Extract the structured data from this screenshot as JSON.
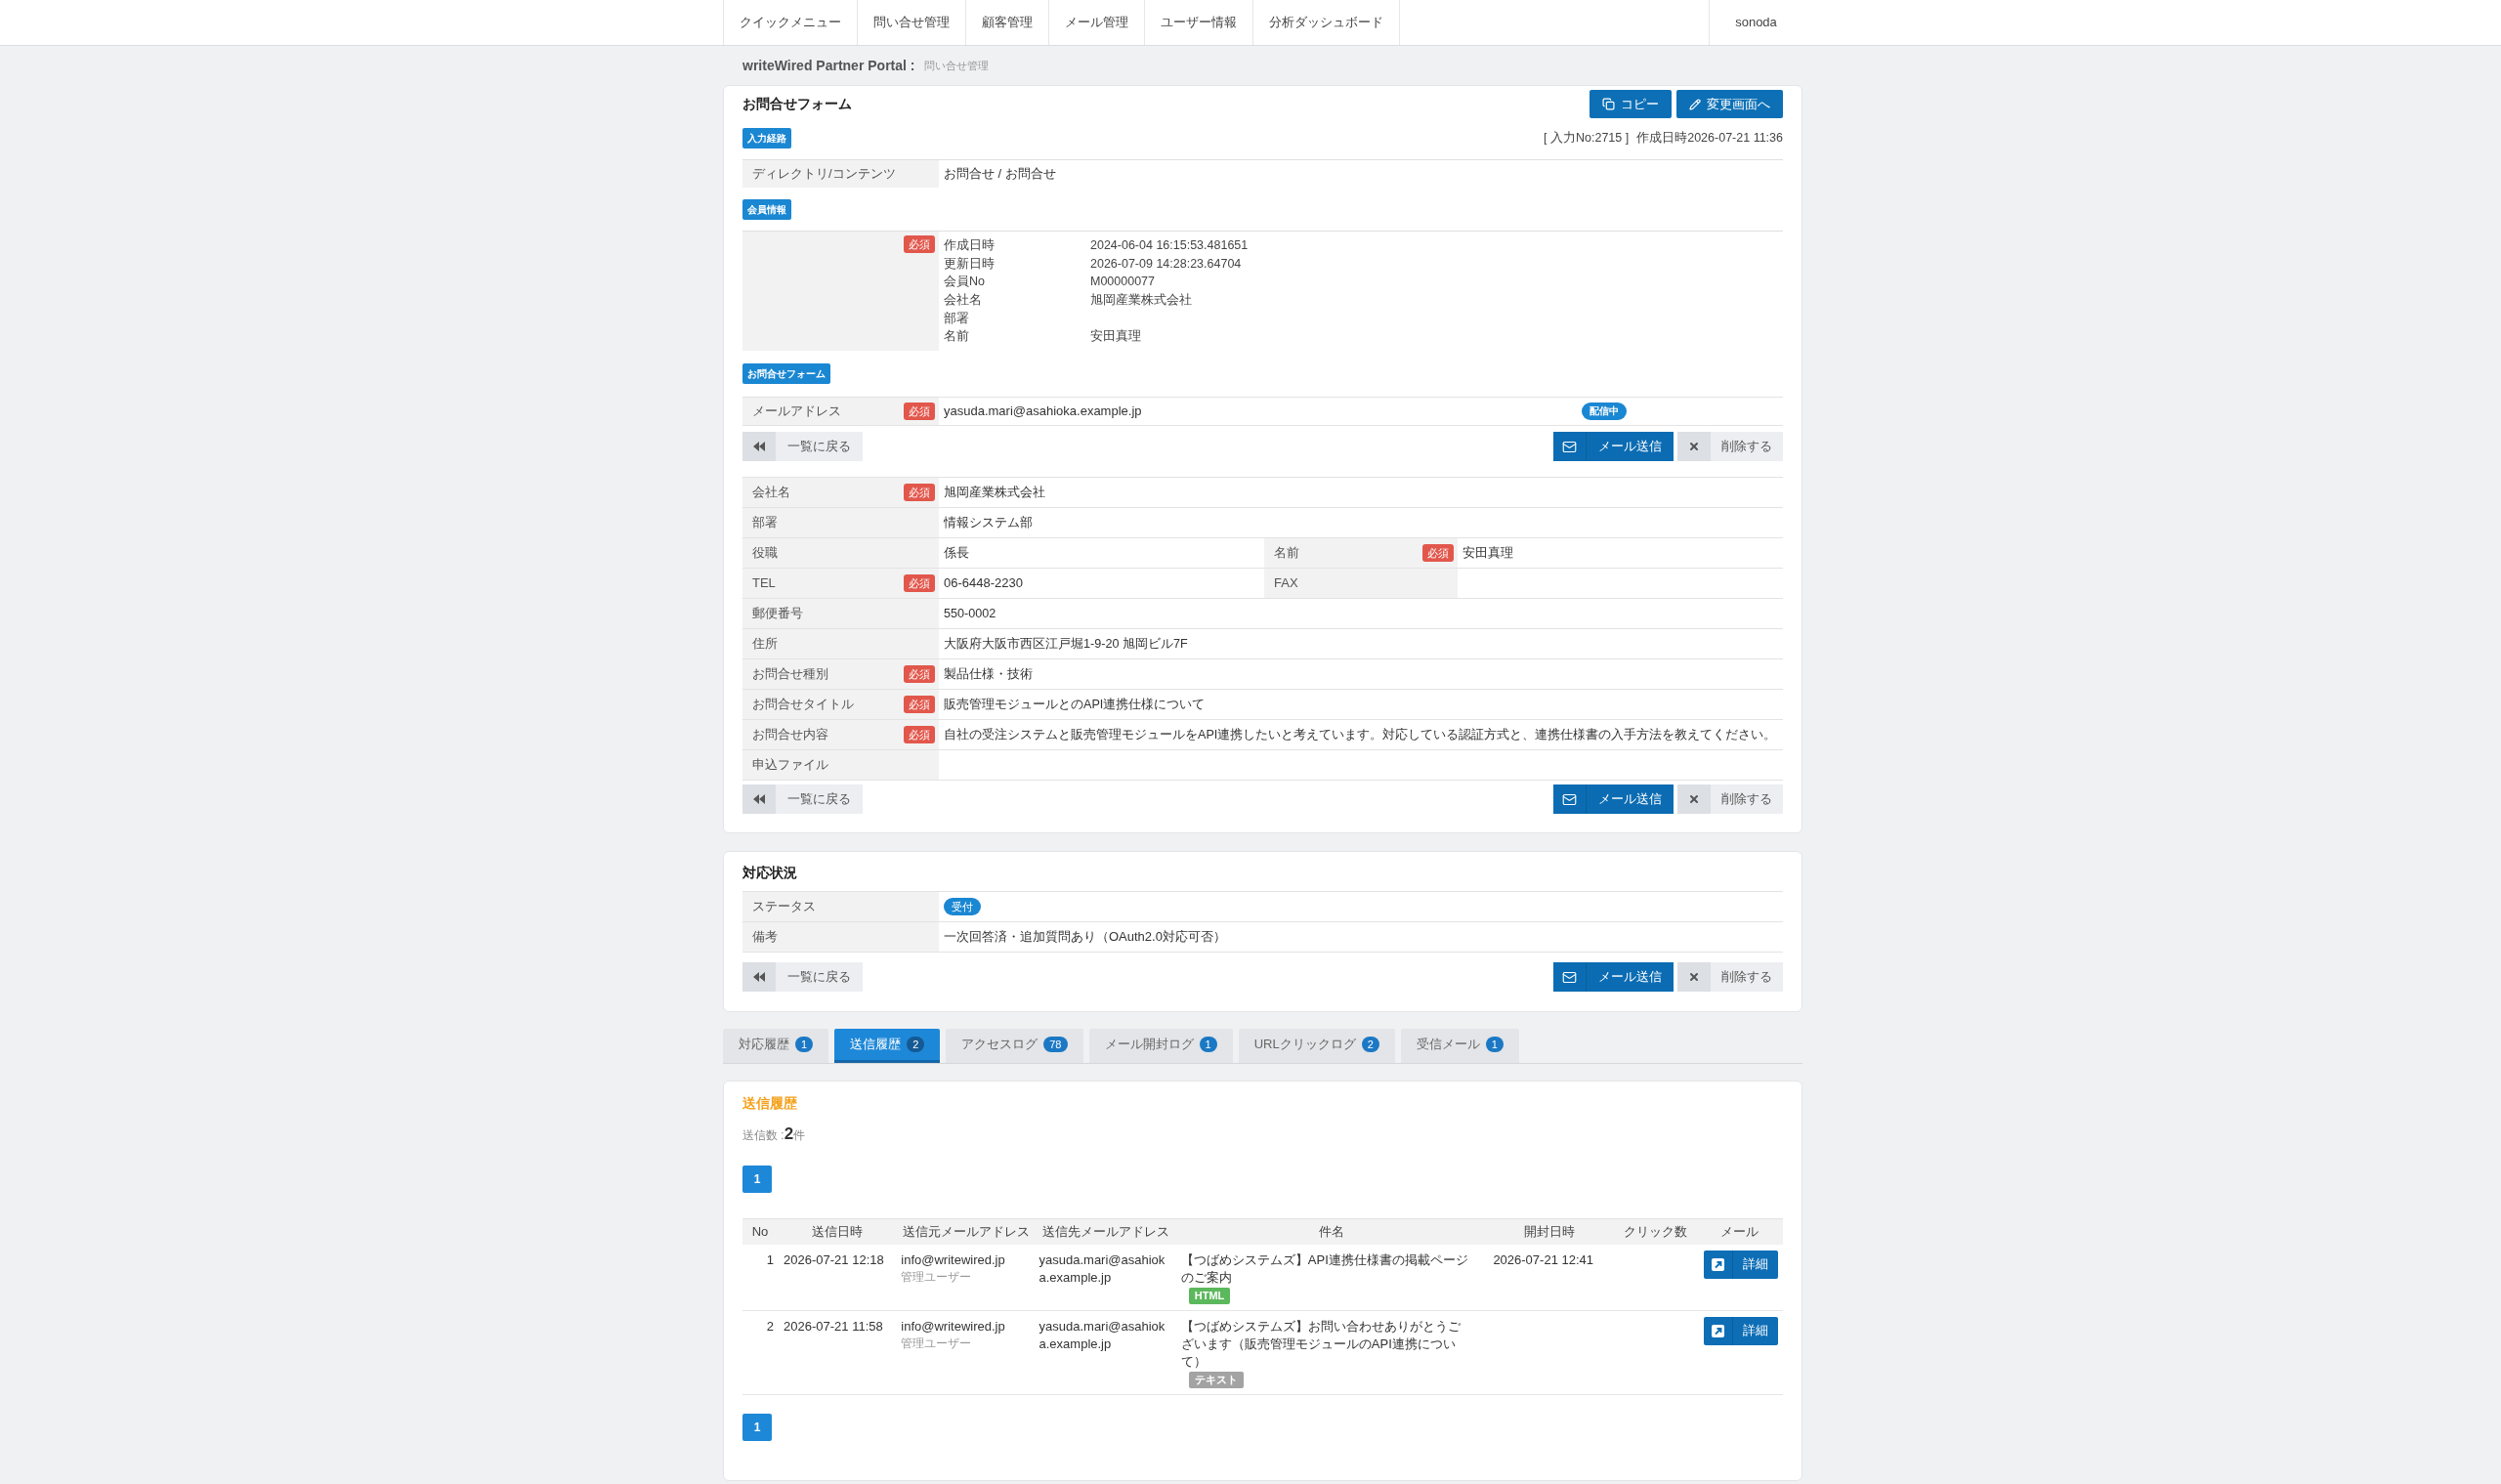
{
  "nav": {
    "items": [
      {
        "label": "クイックメニュー"
      },
      {
        "label": "問い合せ管理"
      },
      {
        "label": "顧客管理"
      },
      {
        "label": "メール管理"
      },
      {
        "label": "ユーザー情報"
      },
      {
        "label": "分析ダッシュボード"
      }
    ],
    "user": "sonoda"
  },
  "breadcrumb": {
    "site": "writeWired Partner Portal :",
    "page": "問い合せ管理"
  },
  "inquiry_form": {
    "title": "お問合せフォーム",
    "actions": [
      {
        "label": "コピー",
        "kind": "copy"
      },
      {
        "label": "変更画面へ",
        "kind": "edit"
      }
    ],
    "entry_no": "[ 入力No:2715 ]",
    "created": "作成日時2026-07-21 11:36",
    "route": {
      "badge": "入力経路",
      "rows": [
        {
          "label": "ディレクトリ/コンテンツ",
          "value": "お問合せ / お問合せ"
        }
      ]
    },
    "member": {
      "badge": "会員情報",
      "required_badge": "必須",
      "fields": [
        {
          "label": "作成日時",
          "value": "2024-06-04 16:15:53.481651"
        },
        {
          "label": "更新日時",
          "value": "2026-07-09 14:28:23.64704"
        },
        {
          "label": "会員No",
          "value": "M00000077"
        },
        {
          "label": "会社名",
          "value": "旭岡産業株式会社"
        },
        {
          "label": "部署"
        },
        {
          "label": "名前",
          "value": "安田真理"
        }
      ]
    },
    "form": {
      "badge": "お問合せフォーム",
      "email": {
        "label": "メールアドレス",
        "required_badge": "必須",
        "value": "yasuda.mari@asahioka.example.jp",
        "status": "配信中"
      },
      "buttons_top": {
        "back": "一覧に戻る",
        "send": "メール送信",
        "delete": "削除する"
      },
      "rows": [
        {
          "cells": [
            {
              "label": "会社名",
              "required_badge": "必須",
              "value": "旭岡産業株式会社"
            }
          ]
        },
        {
          "cells": [
            {
              "label": "部署",
              "value": "情報システム部"
            }
          ]
        },
        {
          "cells": [
            {
              "label": "役職",
              "value": "係長"
            },
            {
              "label": "名前",
              "required_badge": "必須",
              "value": "安田真理"
            }
          ]
        },
        {
          "cells": [
            {
              "label": "TEL",
              "required_badge": "必須",
              "value": "06-6448-2230"
            },
            {
              "label": "FAX"
            }
          ]
        },
        {
          "cells": [
            {
              "label": "郵便番号",
              "value": "550-0002"
            }
          ]
        },
        {
          "cells": [
            {
              "label": "住所",
              "value": "大阪府大阪市西区江戸堀1-9-20 旭岡ビル7F"
            }
          ]
        },
        {
          "cells": [
            {
              "label": "お問合せ種別",
              "required_badge": "必須",
              "value": "製品仕様・技術"
            }
          ]
        },
        {
          "cells": [
            {
              "label": "お問合せタイトル",
              "required_badge": "必須",
              "value": "販売管理モジュールとのAPI連携仕様について"
            }
          ]
        },
        {
          "cells": [
            {
              "label": "お問合せ内容",
              "required_badge": "必須",
              "value": "自社の受注システムと販売管理モジュールをAPI連携したいと考えています。対応している認証方式と、連携仕様書の入手方法を教えてください。"
            }
          ]
        },
        {
          "cells": [
            {
              "label": "申込ファイル"
            }
          ]
        }
      ],
      "buttons_bottom": {
        "back": "一覧に戻る",
        "send": "メール送信",
        "delete": "削除する"
      }
    }
  },
  "response_status": {
    "title": "対応状況",
    "rows": [
      {
        "label": "ステータス",
        "kind": "badge",
        "value": "受付"
      },
      {
        "label": "備考",
        "kind": "text",
        "value": "一次回答済・追加質問あり（OAuth2.0対応可否）"
      }
    ],
    "buttons": {
      "back": "一覧に戻る",
      "send": "メール送信",
      "delete": "削除する"
    }
  },
  "tabs": [
    {
      "label": "対応履歴",
      "count": "1",
      "selected": false
    },
    {
      "label": "送信履歴",
      "count": "2",
      "selected": true
    },
    {
      "label": "アクセスログ",
      "count": "78",
      "selected": false
    },
    {
      "label": "メール開封ログ",
      "count": "1",
      "selected": false
    },
    {
      "label": "URLクリックログ",
      "count": "2",
      "selected": false
    },
    {
      "label": "受信メール",
      "count": "1",
      "selected": false
    }
  ],
  "send_history": {
    "title": "送信履歴",
    "summary": "送信数 :**2**件",
    "pagination_top": [
      {
        "label": "1",
        "selected": true
      }
    ],
    "table": {
      "columns": [
        "No",
        "送信日時",
        "送信元メールアドレス",
        "送信先メールアドレス",
        "件名",
        "開封日時",
        "クリック数",
        "メール"
      ],
      "rows": [
        {
          "no": "1",
          "sent_at": "2026-07-21 12:18",
          "from": "info@writewired.jp",
          "from_role": "管理ユーザー",
          "to": "yasuda.mari@asahioka.example.jp",
          "subject": "【つばめシステムズ】API連携仕様書の掲載ページのご案内",
          "format": {
            "label": "HTML",
            "color": "#5cb85c"
          },
          "opened_at": "2026-07-21 12:41",
          "action": "詳細"
        },
        {
          "no": "2",
          "sent_at": "2026-07-21 11:58",
          "from": "info@writewired.jp",
          "from_role": "管理ユーザー",
          "to": "yasuda.mari@asahioka.example.jp",
          "subject": "【つばめシステムズ】お問い合わせありがとうございます（販売管理モジュールのAPI連携について）",
          "format": {
            "label": "テキスト",
            "color": "#a3a3a3"
          },
          "action": "詳細"
        }
      ]
    },
    "pagination_bottom": [
      {
        "label": "1",
        "selected": true
      }
    ]
  }
}
